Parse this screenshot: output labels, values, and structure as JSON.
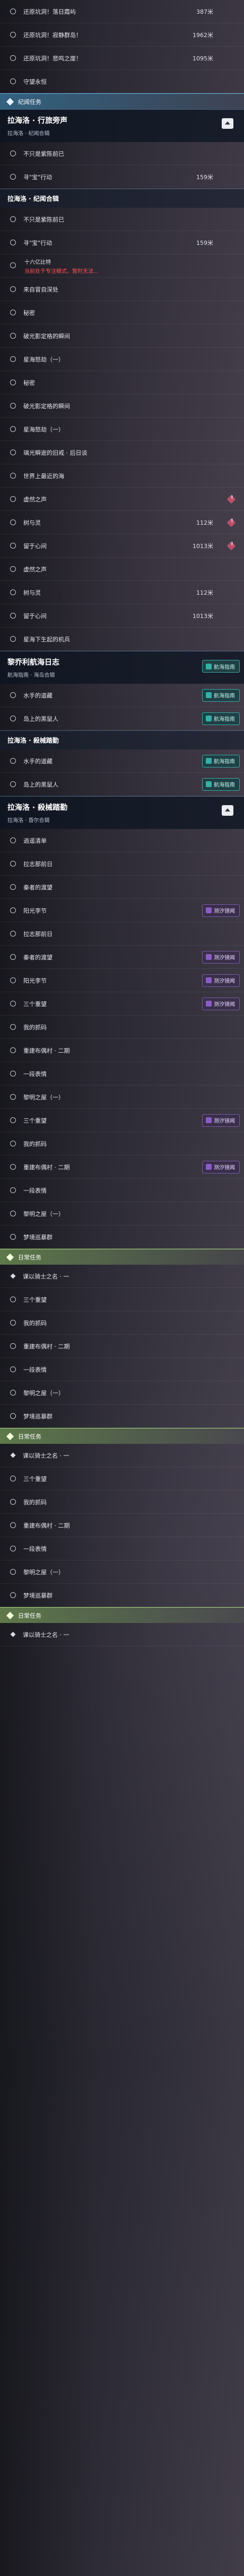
{
  "tasks_a": [
    {
      "label": "还原坑洞！落日霞屿",
      "dist": "387米"
    },
    {
      "label": "还原坑洞！寂静群岛！",
      "dist": "1962米"
    },
    {
      "label": "还原坑洞！悲鸣之崖！",
      "dist": "1095米"
    }
  ],
  "guard": {
    "label": "守望永恒"
  },
  "section_chrono": {
    "title": "纪闻任务"
  },
  "mission_1": {
    "title": "拉海洛 · 行旅旁声",
    "sub": "拉海洛 · 纪闻合辑"
  },
  "tasks_b": [
    {
      "label": "不只是紫陈前已"
    },
    {
      "label": "寻\"宝\"行动",
      "dist": "159米"
    }
  ],
  "header_b": {
    "title": "拉海洛 · 纪闻合辑"
  },
  "tasks_c": [
    {
      "label": "不只是紫陈前已"
    },
    {
      "label": "寻\"宝\"行动",
      "dist": "159米"
    }
  ],
  "tip": {
    "line1": "十六亿比特",
    "line2": "当前处于专注模式，暂时无法..."
  },
  "tasks_d": [
    {
      "label": "来自冒自深处"
    },
    {
      "label": "秘密"
    },
    {
      "label": "破光影定格的瞬间"
    },
    {
      "label": "星海怒劫（一）"
    },
    {
      "label": "秘密"
    },
    {
      "label": "破光影定格的瞬间"
    },
    {
      "label": "星海怒劫（一）"
    },
    {
      "label": "璃光瞬逝的旧戒 · 后日谈"
    },
    {
      "label": "世界上最近的海"
    },
    {
      "label": "虚然之声"
    },
    {
      "label": "树与灵",
      "dist": "112米"
    },
    {
      "label": "留于心间",
      "dist": "1013米"
    }
  ],
  "tasks_e": [
    {
      "label": "虚然之声"
    },
    {
      "label": "树与灵",
      "dist": "112米"
    },
    {
      "label": "留于心间",
      "dist": "1013米"
    },
    {
      "label": "星海下生起的机兵"
    }
  ],
  "mission_2": {
    "title": "黎乔利航海日志",
    "sub": "航海指南 · 海岛合辑",
    "tag": "航海指南"
  },
  "tasks_f": [
    {
      "label": "水手的道藏",
      "tag": "航海指南"
    },
    {
      "label": "岛上的黑鼠人",
      "tag": "航海指南"
    }
  ],
  "header_f": {
    "title": "拉海洛 · 殺械踏勤"
  },
  "tasks_g": [
    {
      "label": "水手的道藏",
      "tag": "航海指南"
    },
    {
      "label": "岛上的黑鼠人",
      "tag": "航海指南"
    }
  ],
  "mission_3": {
    "title": "拉海洛 · 殺械踏勤",
    "sub": "拉海洛 · 昏尔合辑"
  },
  "tasks_h": [
    {
      "label": "逍遥清单"
    },
    {
      "label": "拉志那前日"
    },
    {
      "label": "秦者的渡望"
    },
    {
      "label": "阳光李节",
      "tag": "测汐镜闻"
    }
  ],
  "tasks_i": [
    {
      "label": "拉志那前日"
    },
    {
      "label": "秦者的渡望",
      "tag": "测汐镜闻"
    },
    {
      "label": "阳光李节",
      "tag": "测汐镜闻"
    },
    {
      "label": "三个重望",
      "tag": "测汐镜闻"
    },
    {
      "label": "我的抓码"
    },
    {
      "label": "重建布偶村 · 二期"
    },
    {
      "label": "一段表情"
    },
    {
      "label": "黎明之屋（一）"
    }
  ],
  "tasks_j": [
    {
      "label": "三个重望",
      "tag": "测汐镜闻"
    },
    {
      "label": "我的抓码"
    },
    {
      "label": "重建布偶村 · 二期",
      "tag": "测汐镜闻"
    },
    {
      "label": "一段表情"
    },
    {
      "label": "黎明之屋（一）"
    },
    {
      "label": "梦境巡暴群"
    }
  ],
  "section_daily_1": {
    "title": "日常任务"
  },
  "daily_1": [
    {
      "label": "课以骑士之名 · 一"
    }
  ],
  "tasks_k": [
    {
      "label": "三个重望"
    },
    {
      "label": "我的抓码"
    },
    {
      "label": "重建布偶村 · 二期"
    },
    {
      "label": "一段表情"
    },
    {
      "label": "黎明之屋（一）"
    },
    {
      "label": "梦境巡暴群"
    }
  ],
  "section_daily_2": {
    "title": "日常任务"
  },
  "daily_2": [
    {
      "label": "课以骑士之名 · 一"
    }
  ],
  "tasks_l": [
    {
      "label": "三个重望"
    },
    {
      "label": "我的抓码"
    },
    {
      "label": "重建布偶村 · 二期"
    },
    {
      "label": "一段表情"
    },
    {
      "label": "黎明之屋（一）"
    },
    {
      "label": "梦境巡暴群"
    }
  ],
  "section_daily_3": {
    "title": "日常任务"
  },
  "daily_3": [
    {
      "label": "课以骑士之名 · 一"
    }
  ]
}
